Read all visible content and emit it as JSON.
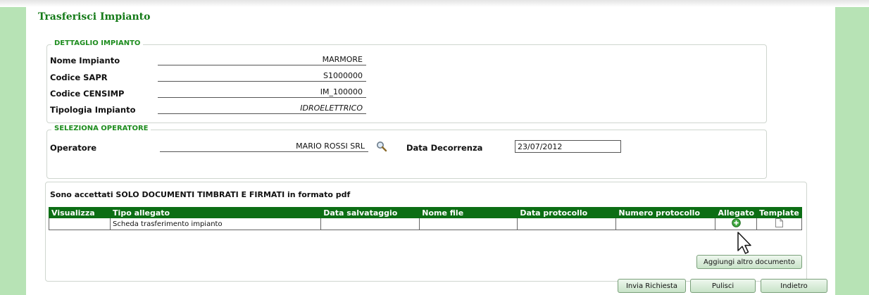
{
  "page": {
    "title": "Trasferisci Impianto"
  },
  "dettaglio": {
    "legend": "DETTAGLIO IMPIANTO",
    "fields": [
      {
        "label": "Nome Impianto",
        "value": "MARMORE"
      },
      {
        "label": "Codice SAPR",
        "value": "S1000000"
      },
      {
        "label": "Codice CENSIMP",
        "value": "IM_100000"
      },
      {
        "label": "Tipologia Impianto",
        "value": "IDROELETTRICO"
      }
    ]
  },
  "operatore": {
    "legend": "SELEZIONA OPERATORE",
    "operatore_label": "Operatore",
    "operatore_value": "MARIO ROSSI SRL",
    "search_icon": "magnifier-icon",
    "data_label": "Data Decorrenza",
    "data_value": "23/07/2012"
  },
  "allegati": {
    "note": "Sono accettati SOLO DOCUMENTI TIMBRATI E FIRMATI in formato pdf",
    "columns": [
      "Visualizza",
      "Tipo allegato",
      "Data salvataggio",
      "Nome file",
      "Data protocollo",
      "Numero protocollo",
      "Allegato",
      "Template"
    ],
    "rows": [
      {
        "visualizza": "",
        "tipo": "Scheda trasferimento impianto",
        "data_salvataggio": "",
        "nome_file": "",
        "data_protocollo": "",
        "numero_protocollo": "",
        "allegato_icon": "add-attachment-icon",
        "template_icon": "document-icon"
      }
    ],
    "add_button": "Aggiungi altro documento"
  },
  "actions": {
    "invia": "Invia Richiesta",
    "pulisci": "Pulisci",
    "indietro": "Indietro"
  },
  "colors": {
    "accent": "#147a18",
    "side": "#b7e3b5",
    "header": "#0c6e14"
  }
}
